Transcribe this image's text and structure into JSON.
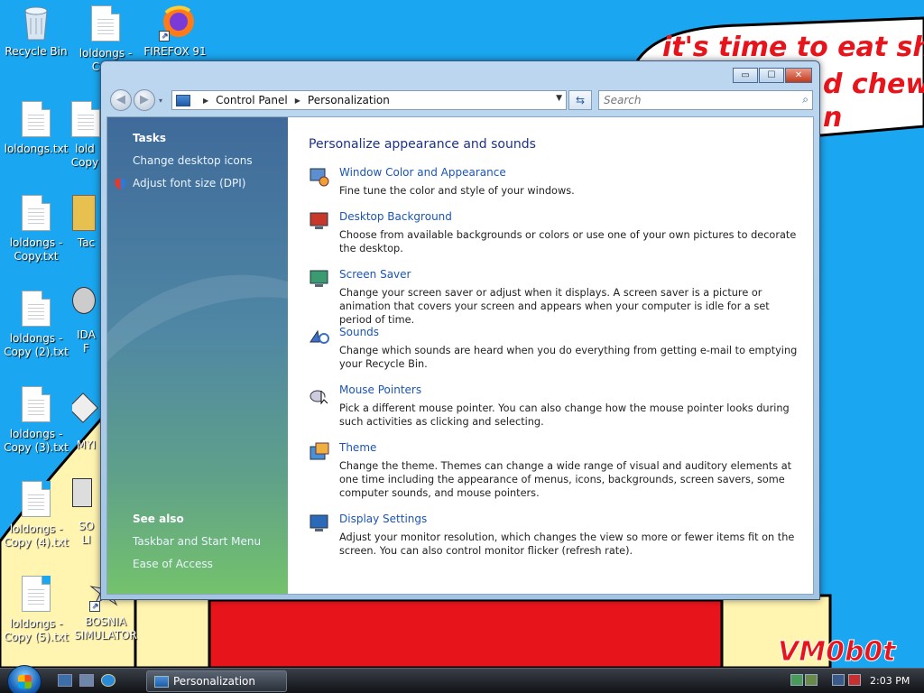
{
  "desktop": {
    "icons": [
      {
        "label": "Recycle Bin",
        "type": "recycle"
      },
      {
        "label": "loldongs - Copy",
        "type": "file"
      },
      {
        "label": "FIREFOX 91",
        "type": "firefox"
      },
      {
        "label": "loldongs.txt",
        "type": "file"
      },
      {
        "label": "lold Copy",
        "type": "file"
      },
      {
        "label": "loldongs - Copy.txt",
        "type": "file"
      },
      {
        "label": "Tac",
        "type": "app"
      },
      {
        "label": "loldongs - Copy (2).txt",
        "type": "file"
      },
      {
        "label": "IDA F",
        "type": "app"
      },
      {
        "label": "loldongs - Copy (3).txt",
        "type": "file"
      },
      {
        "label": "MYI",
        "type": "app"
      },
      {
        "label": "loldongs - Copy (4).txt",
        "type": "file"
      },
      {
        "label": "SO LI",
        "type": "app"
      },
      {
        "label": "loldongs - Copy (5).txt",
        "type": "file"
      },
      {
        "label": "BOSNIA SIMULATOR",
        "type": "app"
      }
    ],
    "wallpaper_text_1": "it's time to eat shit",
    "wallpaper_text_2": "d chew",
    "wallpaper_text_3": "n",
    "signature": "VM0b0t",
    "colors": {
      "sky": "#1aa6f0",
      "red": "#e8141c",
      "yellow": "#fff4b0"
    }
  },
  "window": {
    "title_buttons": {
      "minimize": "▭",
      "maximize": "☐",
      "close": "✕"
    },
    "nav": {
      "back": "◀",
      "forward": "▶"
    },
    "address": {
      "crumbs": [
        "Control Panel",
        "Personalization"
      ]
    },
    "search": {
      "placeholder": "Search"
    },
    "sidebar": {
      "tasks_heading": "Tasks",
      "tasks": [
        "Change desktop icons",
        "Adjust font size (DPI)"
      ],
      "see_also_heading": "See also",
      "see_also": [
        "Taskbar and Start Menu",
        "Ease of Access"
      ]
    },
    "main": {
      "title": "Personalize appearance and sounds",
      "items": [
        {
          "link": "Window Color and Appearance",
          "desc": "Fine tune the color and style of your windows.",
          "icon": "window-color-icon"
        },
        {
          "link": "Desktop Background",
          "desc": "Choose from available backgrounds or colors or use one of your own pictures to decorate the desktop.",
          "icon": "desktop-background-icon"
        },
        {
          "link": "Screen Saver",
          "desc": "Change your screen saver or adjust when it displays. A screen saver is a picture or animation that covers your screen and appears when your computer is idle for a set period of time.",
          "icon": "screen-saver-icon"
        },
        {
          "link": "Sounds",
          "desc": "Change which sounds are heard when you do everything from getting e-mail to emptying your Recycle Bin.",
          "icon": "sounds-icon"
        },
        {
          "link": "Mouse Pointers",
          "desc": "Pick a different mouse pointer. You can also change how the mouse pointer looks during such activities as clicking and selecting.",
          "icon": "mouse-pointer-icon"
        },
        {
          "link": "Theme",
          "desc": "Change the theme. Themes can change a wide range of visual and auditory elements at one time including the appearance of menus, icons, backgrounds, screen savers, some computer sounds, and mouse pointers.",
          "icon": "theme-icon"
        },
        {
          "link": "Display Settings",
          "desc": "Adjust your monitor resolution, which changes the view so more or fewer items fit on the screen. You can also control monitor flicker (refresh rate).",
          "icon": "display-settings-icon"
        }
      ]
    }
  },
  "taskbar": {
    "active_task": "Personalization",
    "clock": "2:03 PM"
  }
}
